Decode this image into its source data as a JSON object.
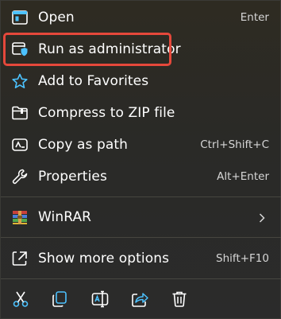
{
  "menu": {
    "items": [
      {
        "id": "open",
        "label": "Open",
        "shortcut": "Enter",
        "icon": "open-window-icon"
      },
      {
        "id": "run-as-admin",
        "label": "Run as administrator",
        "shortcut": "",
        "icon": "shield-window-icon",
        "highlighted": true
      },
      {
        "id": "add-favorites",
        "label": "Add to Favorites",
        "shortcut": "",
        "icon": "star-icon"
      },
      {
        "id": "compress-zip",
        "label": "Compress to ZIP file",
        "shortcut": "",
        "icon": "zip-folder-icon"
      },
      {
        "id": "copy-path",
        "label": "Copy as path",
        "shortcut": "Ctrl+Shift+C",
        "icon": "copy-path-icon"
      },
      {
        "id": "properties",
        "label": "Properties",
        "shortcut": "Alt+Enter",
        "icon": "wrench-icon"
      },
      {
        "id": "winrar",
        "label": "WinRAR",
        "shortcut": "",
        "icon": "winrar-icon",
        "submenu": true
      },
      {
        "id": "show-more",
        "label": "Show more options",
        "shortcut": "Shift+F10",
        "icon": "expand-icon"
      }
    ],
    "actions": [
      {
        "id": "cut",
        "icon": "scissors-icon"
      },
      {
        "id": "copy",
        "icon": "copy-icon"
      },
      {
        "id": "rename",
        "icon": "rename-icon"
      },
      {
        "id": "share",
        "icon": "share-icon"
      },
      {
        "id": "delete",
        "icon": "trash-icon"
      }
    ]
  },
  "colors": {
    "accent": "#4cc2ff",
    "highlight_border": "#e5483b",
    "text": "#ffffff",
    "shortcut_text": "#d6d6d6"
  }
}
